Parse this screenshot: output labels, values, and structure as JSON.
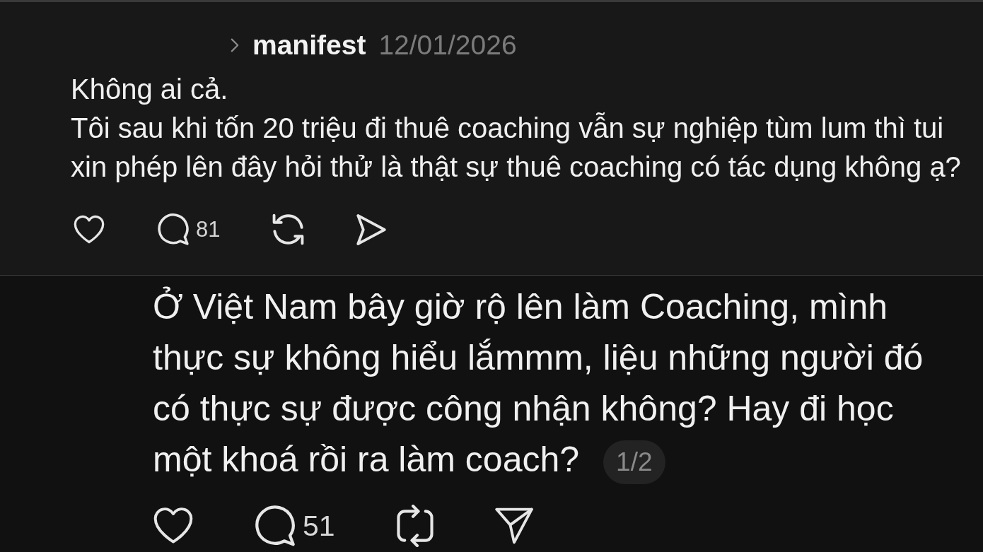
{
  "post": {
    "topic": "manifest",
    "date": "12/01/2026",
    "text": "Không ai cả.\nTôi sau khi tốn 20 triệu đi thuê coaching vẫn sự nghiệp tùm lum thì tui xin phép lên đây hỏi thử là thật sự thuê coaching có tác dụng không ạ?",
    "actions": [
      {
        "kind": "like"
      },
      {
        "kind": "comment",
        "count": "81"
      },
      {
        "kind": "repost"
      },
      {
        "kind": "share"
      }
    ]
  },
  "reply": {
    "text": "Ở Việt Nam bây giờ rộ lên làm Coaching, mình thực sự không hiểu lắmmm, liệu những người đó có thực sự được công nhận không? Hay đi học một khoá rồi ra làm coach?",
    "page_indicator": "1/2",
    "actions": [
      {
        "kind": "like"
      },
      {
        "kind": "comment",
        "count": "51"
      },
      {
        "kind": "repost"
      },
      {
        "kind": "share"
      }
    ]
  }
}
